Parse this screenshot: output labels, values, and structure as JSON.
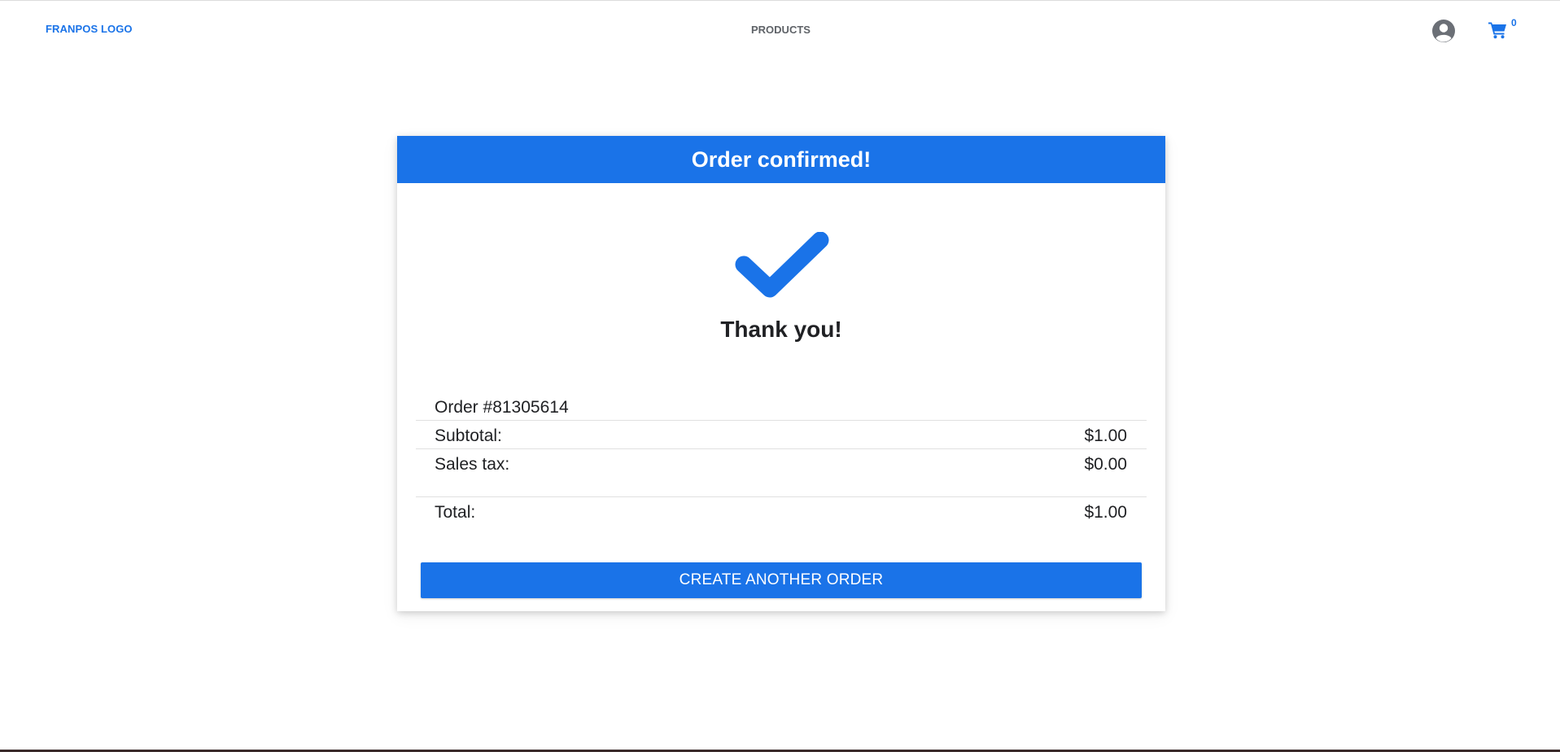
{
  "nav": {
    "logo": "FRANPOS LOGO",
    "products": "PRODUCTS",
    "cart_count": "0",
    "account_icon": "account-circle-icon",
    "cart_icon": "shopping-cart-icon"
  },
  "card": {
    "title": "Order confirmed!",
    "check_icon": "checkmark-icon",
    "thank_you": "Thank you!",
    "order_number": "Order #81305614",
    "rows": [
      {
        "label": "Subtotal:",
        "value": "$1.00"
      },
      {
        "label": "Sales tax:",
        "value": "$0.00"
      },
      {
        "label": "Total:",
        "value": "$1.00"
      }
    ],
    "button_label": "CREATE ANOTHER ORDER"
  },
  "colors": {
    "primary": "#1a73e8",
    "text": "#202124",
    "nav_text": "#5f6368",
    "icon_gray": "#6b6f76"
  }
}
